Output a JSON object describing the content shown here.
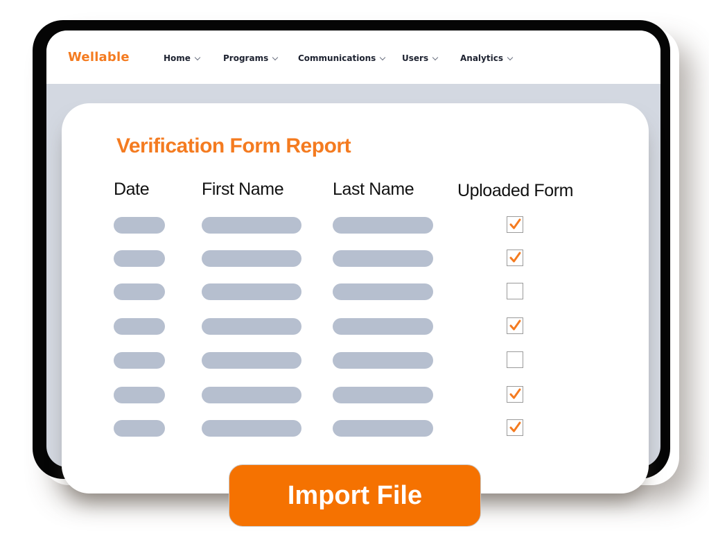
{
  "app": {
    "logo": "Wellable",
    "brand_color": "#f47b20"
  },
  "nav": {
    "items": [
      {
        "label": "Home",
        "icon": "chevron-down-icon"
      },
      {
        "label": "Programs",
        "icon": "chevron-down-icon"
      },
      {
        "label": "Communications",
        "icon": "chevron-down-icon"
      },
      {
        "label": "Users",
        "icon": "chevron-down-icon"
      },
      {
        "label": "Analytics",
        "icon": "chevron-down-icon"
      }
    ]
  },
  "report": {
    "title": "Verification Form Report",
    "columns": [
      "Date",
      "First Name",
      "Last Name",
      "Uploaded Form"
    ],
    "rows": [
      {
        "date": "",
        "first_name": "",
        "last_name": "",
        "uploaded": true
      },
      {
        "date": "",
        "first_name": "",
        "last_name": "",
        "uploaded": true
      },
      {
        "date": "",
        "first_name": "",
        "last_name": "",
        "uploaded": false
      },
      {
        "date": "",
        "first_name": "",
        "last_name": "",
        "uploaded": true
      },
      {
        "date": "",
        "first_name": "",
        "last_name": "",
        "uploaded": false
      },
      {
        "date": "",
        "first_name": "",
        "last_name": "",
        "uploaded": true
      },
      {
        "date": "",
        "first_name": "",
        "last_name": "",
        "uploaded": true
      }
    ],
    "placeholder_color": "#b6bfcf",
    "check_color": "#f47b20"
  },
  "actions": {
    "import_label": "Import File",
    "import_color": "#f57201"
  }
}
